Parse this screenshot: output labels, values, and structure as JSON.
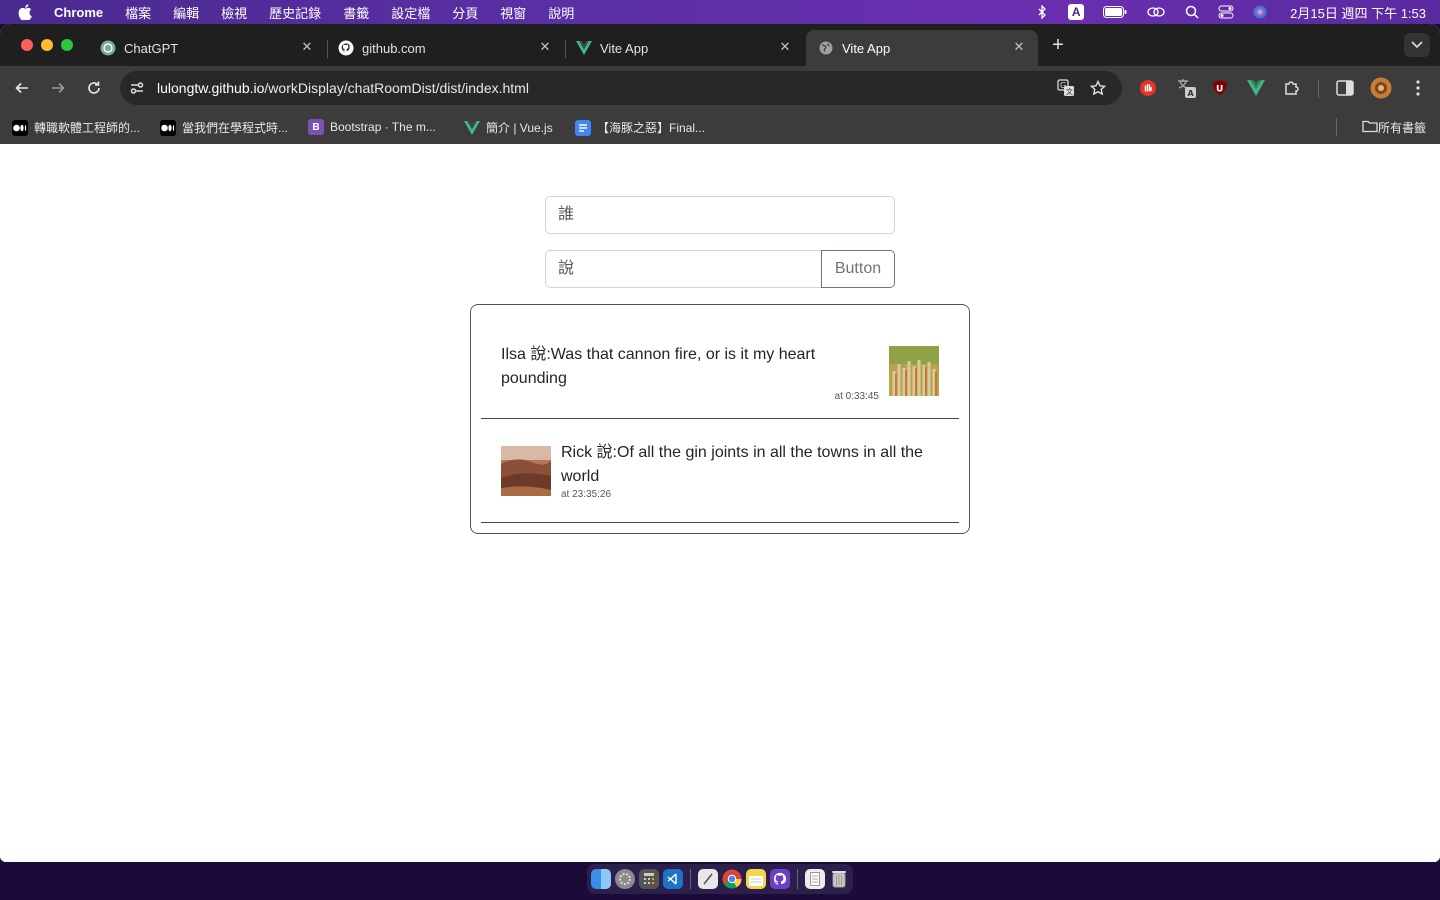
{
  "menubar": {
    "app_name": "Chrome",
    "items": [
      "檔案",
      "編輯",
      "檢視",
      "歷史記錄",
      "書籤",
      "設定檔",
      "分頁",
      "視窗",
      "說明"
    ],
    "input_method": "A",
    "clock": "2月15日 週四 下午 1:53"
  },
  "tabs": [
    {
      "title": "ChatGPT",
      "icon": "chatgpt-icon",
      "active": false
    },
    {
      "title": "github.com",
      "icon": "github-icon",
      "active": false
    },
    {
      "title": "Vite App",
      "icon": "vue-icon",
      "active": false
    },
    {
      "title": "Vite App",
      "icon": "globe-icon",
      "active": true
    }
  ],
  "toolbar": {
    "url_host": "lulongtw.github.io",
    "url_path": "/workDisplay/chatRoomDist/dist/index.html"
  },
  "bookmarks": {
    "items": [
      {
        "label": "轉職軟體工程師的...",
        "icon": "medium-icon"
      },
      {
        "label": "當我們在學程式時...",
        "icon": "medium-icon"
      },
      {
        "label": "Bootstrap · The m...",
        "icon": "bootstrap-icon"
      },
      {
        "label": "簡介 | Vue.js",
        "icon": "vue-icon"
      },
      {
        "label": "【海豚之惡】Final...",
        "icon": "docs-icon"
      }
    ],
    "all_bookmarks": "所有書籤"
  },
  "form": {
    "who_placeholder": "誰",
    "say_placeholder": "說",
    "button_label": "Button"
  },
  "messages": [
    {
      "text": "Ilsa 說:Was that cannon fire, or is it my heart pounding",
      "time": "at 0:33:45",
      "side": "right"
    },
    {
      "text": "Rick 說:Of all the gin joints in all the towns in all the world",
      "time": "at 23:35:26",
      "side": "left"
    }
  ],
  "colors": {
    "menubar": "#5b2fa6",
    "tabstrip": "#1f1f1f",
    "toolbar": "#3c3c3c",
    "button_outline": "#6c757d"
  }
}
